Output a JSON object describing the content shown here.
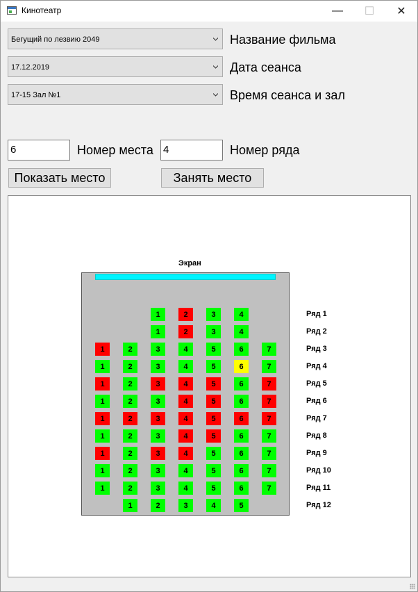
{
  "window": {
    "title": "Кинотеатр",
    "minimize": "—",
    "maximize": "☐",
    "close": "✕"
  },
  "form": {
    "film": {
      "value": "Бегущий по лезвию 2049",
      "label": "Название фильма"
    },
    "date": {
      "value": "17.12.2019",
      "label": "Дата сеанса"
    },
    "time": {
      "value": "17-15 Зал №1",
      "label": "Время сеанса и зал"
    },
    "seat_number": {
      "value": "6",
      "label": "Номер места"
    },
    "row_number": {
      "value": "4",
      "label": "Номер ряда"
    },
    "show_button": "Показать место",
    "take_button": "Занять место"
  },
  "hall": {
    "screen_label": "Экран",
    "status_colors": {
      "free": "#00ff00",
      "occupied": "#ff0000",
      "selected": "#ffff00"
    },
    "rows": [
      {
        "label": "Ряд 1",
        "seats": [
          {
            "n": "1",
            "s": "free"
          },
          {
            "n": "2",
            "s": "occupied"
          },
          {
            "n": "3",
            "s": "free"
          },
          {
            "n": "4",
            "s": "free"
          }
        ]
      },
      {
        "label": "Ряд 2",
        "seats": [
          {
            "n": "1",
            "s": "free"
          },
          {
            "n": "2",
            "s": "occupied"
          },
          {
            "n": "3",
            "s": "free"
          },
          {
            "n": "4",
            "s": "free"
          }
        ]
      },
      {
        "label": "Ряд 3",
        "seats": [
          {
            "n": "1",
            "s": "occupied"
          },
          {
            "n": "2",
            "s": "free"
          },
          {
            "n": "3",
            "s": "free"
          },
          {
            "n": "4",
            "s": "free"
          },
          {
            "n": "5",
            "s": "free"
          },
          {
            "n": "6",
            "s": "free"
          },
          {
            "n": "7",
            "s": "free"
          }
        ]
      },
      {
        "label": "Ряд 4",
        "seats": [
          {
            "n": "1",
            "s": "free"
          },
          {
            "n": "2",
            "s": "free"
          },
          {
            "n": "3",
            "s": "free"
          },
          {
            "n": "4",
            "s": "free"
          },
          {
            "n": "5",
            "s": "free"
          },
          {
            "n": "6",
            "s": "selected"
          },
          {
            "n": "7",
            "s": "free"
          }
        ]
      },
      {
        "label": "Ряд 5",
        "seats": [
          {
            "n": "1",
            "s": "occupied"
          },
          {
            "n": "2",
            "s": "free"
          },
          {
            "n": "3",
            "s": "occupied"
          },
          {
            "n": "4",
            "s": "occupied"
          },
          {
            "n": "5",
            "s": "occupied"
          },
          {
            "n": "6",
            "s": "free"
          },
          {
            "n": "7",
            "s": "occupied"
          }
        ]
      },
      {
        "label": "Ряд 6",
        "seats": [
          {
            "n": "1",
            "s": "free"
          },
          {
            "n": "2",
            "s": "free"
          },
          {
            "n": "3",
            "s": "free"
          },
          {
            "n": "4",
            "s": "occupied"
          },
          {
            "n": "5",
            "s": "occupied"
          },
          {
            "n": "6",
            "s": "free"
          },
          {
            "n": "7",
            "s": "occupied"
          }
        ]
      },
      {
        "label": "Ряд 7",
        "seats": [
          {
            "n": "1",
            "s": "occupied"
          },
          {
            "n": "2",
            "s": "occupied"
          },
          {
            "n": "3",
            "s": "occupied"
          },
          {
            "n": "4",
            "s": "occupied"
          },
          {
            "n": "5",
            "s": "occupied"
          },
          {
            "n": "6",
            "s": "occupied"
          },
          {
            "n": "7",
            "s": "occupied"
          }
        ]
      },
      {
        "label": "Ряд 8",
        "seats": [
          {
            "n": "1",
            "s": "free"
          },
          {
            "n": "2",
            "s": "free"
          },
          {
            "n": "3",
            "s": "free"
          },
          {
            "n": "4",
            "s": "occupied"
          },
          {
            "n": "5",
            "s": "occupied"
          },
          {
            "n": "6",
            "s": "free"
          },
          {
            "n": "7",
            "s": "free"
          }
        ]
      },
      {
        "label": "Ряд 9",
        "seats": [
          {
            "n": "1",
            "s": "occupied"
          },
          {
            "n": "2",
            "s": "free"
          },
          {
            "n": "3",
            "s": "occupied"
          },
          {
            "n": "4",
            "s": "occupied"
          },
          {
            "n": "5",
            "s": "free"
          },
          {
            "n": "6",
            "s": "free"
          },
          {
            "n": "7",
            "s": "free"
          }
        ]
      },
      {
        "label": "Ряд 10",
        "seats": [
          {
            "n": "1",
            "s": "free"
          },
          {
            "n": "2",
            "s": "free"
          },
          {
            "n": "3",
            "s": "free"
          },
          {
            "n": "4",
            "s": "free"
          },
          {
            "n": "5",
            "s": "free"
          },
          {
            "n": "6",
            "s": "free"
          },
          {
            "n": "7",
            "s": "free"
          }
        ]
      },
      {
        "label": "Ряд 11",
        "seats": [
          {
            "n": "1",
            "s": "free"
          },
          {
            "n": "2",
            "s": "free"
          },
          {
            "n": "3",
            "s": "free"
          },
          {
            "n": "4",
            "s": "free"
          },
          {
            "n": "5",
            "s": "free"
          },
          {
            "n": "6",
            "s": "free"
          },
          {
            "n": "7",
            "s": "free"
          }
        ]
      },
      {
        "label": "Ряд 12",
        "seats": [
          {
            "n": "1",
            "s": "free"
          },
          {
            "n": "2",
            "s": "free"
          },
          {
            "n": "3",
            "s": "free"
          },
          {
            "n": "4",
            "s": "free"
          },
          {
            "n": "5",
            "s": "free"
          }
        ]
      }
    ]
  }
}
